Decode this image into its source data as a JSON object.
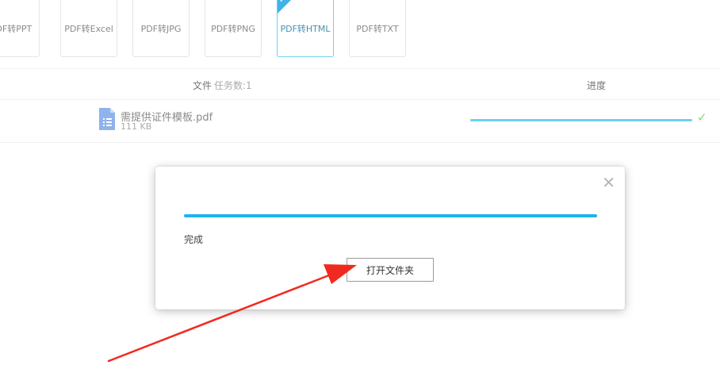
{
  "tabs": [
    {
      "label": "PDF转PPT",
      "active": false
    },
    {
      "label": "PDF转Excel",
      "active": false
    },
    {
      "label": "PDF转JPG",
      "active": false
    },
    {
      "label": "PDF转PNG",
      "active": false
    },
    {
      "label": "PDF转HTML",
      "active": true
    },
    {
      "label": "PDF转TXT",
      "active": false
    }
  ],
  "table": {
    "file_header": "文件",
    "task_count": "任务数:1",
    "progress_header": "进度"
  },
  "file": {
    "name": "需提供证件模板.pdf",
    "size": "111 KB",
    "progress": 1.0,
    "status_icon": "check-icon"
  },
  "dialog": {
    "progress": 1.0,
    "status": "完成",
    "open_folder_label": "打开文件夹",
    "close_icon": "close-icon"
  },
  "colors": {
    "accent": "#1cb4ee",
    "row_progress": "#6cd1f3",
    "success": "#9bd26b",
    "annotation_arrow": "#f02a1e"
  }
}
